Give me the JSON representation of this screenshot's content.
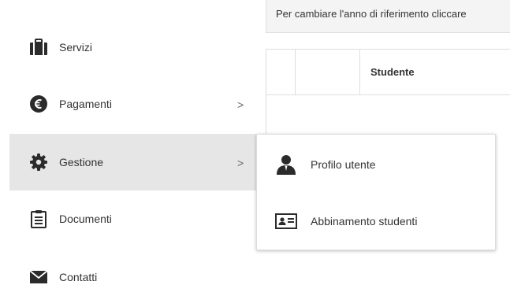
{
  "sidebar": {
    "items": [
      {
        "label": "Servizi",
        "icon": "briefcase-icon"
      },
      {
        "label": "Pagamenti",
        "icon": "euro-icon",
        "chevron": ">"
      },
      {
        "label": "Gestione",
        "icon": "gear-icon",
        "chevron": ">",
        "active": true
      },
      {
        "label": "Documenti",
        "icon": "clipboard-icon"
      },
      {
        "label": "Contatti",
        "icon": "envelope-icon"
      }
    ]
  },
  "notice": {
    "text": "Per cambiare l'anno di riferimento cliccare"
  },
  "table": {
    "columns": [
      "",
      "",
      "Studente"
    ]
  },
  "submenu": {
    "items": [
      {
        "label": "Profilo utente",
        "icon": "user-icon"
      },
      {
        "label": "Abbinamento studenti",
        "icon": "id-card-icon"
      }
    ]
  },
  "colors": {
    "active_background": "#e6e6e6",
    "icon": "#2b2b2b",
    "notice_background": "#f4f4f4",
    "border": "#dddddd"
  }
}
